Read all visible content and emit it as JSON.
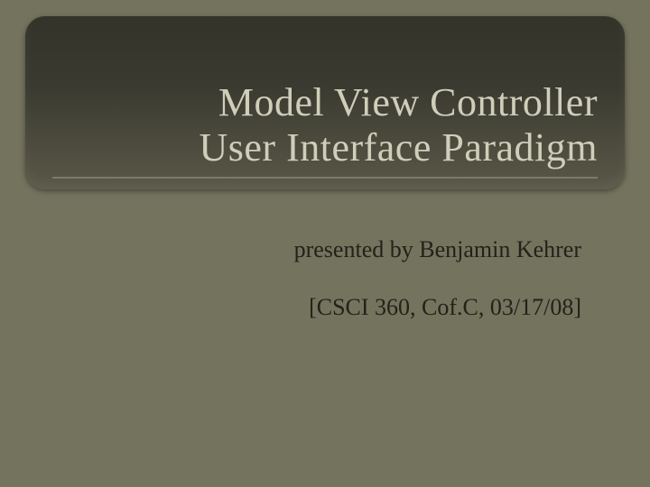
{
  "title": {
    "line1": "Model View Controller",
    "line2": "User Interface Paradigm"
  },
  "presenter": "presented by Benjamin Kehrer",
  "course_info": "[CSCI 360, Cof.C, 03/17/08]"
}
